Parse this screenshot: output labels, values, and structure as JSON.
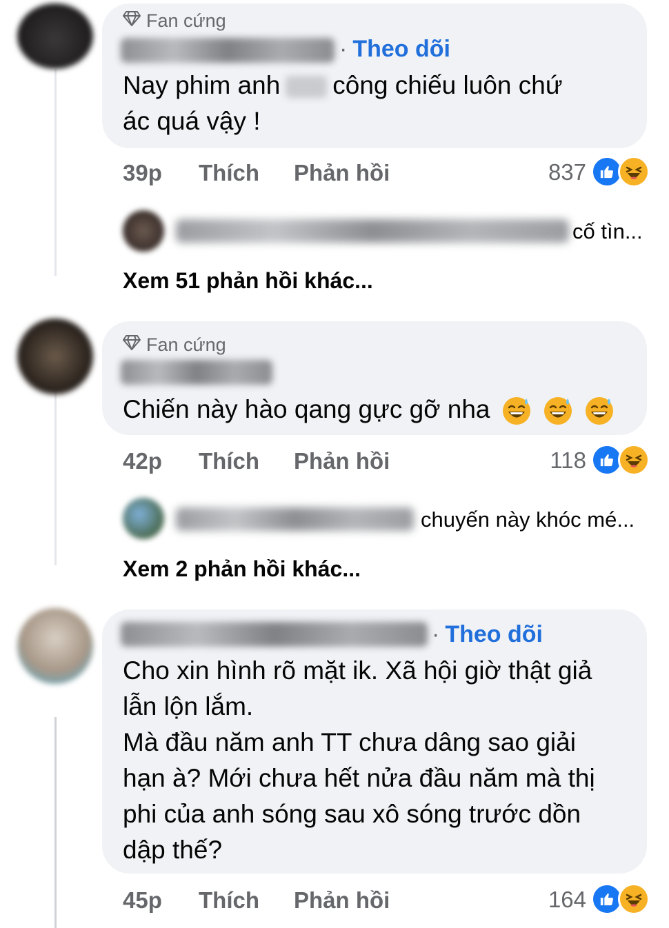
{
  "comments": [
    {
      "badge": "Fan cứng",
      "follow": "Theo dõi",
      "text_a": "Nay phim anh",
      "text_b": "công chiếu luôn chứ",
      "text_c": "ác quá vậy !",
      "time": "39p",
      "like_label": "Thích",
      "reply_label": "Phản hồi",
      "reaction_count": "837",
      "reply_preview": "cố tìn...",
      "more_replies": "Xem 51 phản hồi khác..."
    },
    {
      "badge": "Fan cứng",
      "text": "Chiến này hào qang gực gỡ nha",
      "time": "42p",
      "like_label": "Thích",
      "reply_label": "Phản hồi",
      "reaction_count": "118",
      "reply_preview": "chuyến này khóc mé...",
      "more_replies": "Xem 2 phản hồi khác..."
    },
    {
      "follow": "Theo dõi",
      "lines": [
        "Cho xin hình rõ mặt ik. Xã hội giờ thật giả",
        "lẫn lộn lắm.",
        "Mà đầu năm anh TT chưa dâng sao giải",
        "hạn à? Mới chưa hết nửa đầu năm mà thị",
        "phi của anh sóng sau xô sóng trước dồn",
        "dập thế?"
      ],
      "time": "45p",
      "like_label": "Thích",
      "reply_label": "Phản hồi",
      "reaction_count": "164"
    }
  ],
  "icons": {
    "badge": "diamond-icon",
    "like": "thumbs-up-icon",
    "haha": "laughing-face-icon",
    "sweat": "grinning-sweat-emoji"
  },
  "colors": {
    "bubble": "#f0f2f5",
    "link": "#216fdb",
    "muted": "#65676b",
    "like": "#1877f2",
    "haha": "#f7b125"
  }
}
